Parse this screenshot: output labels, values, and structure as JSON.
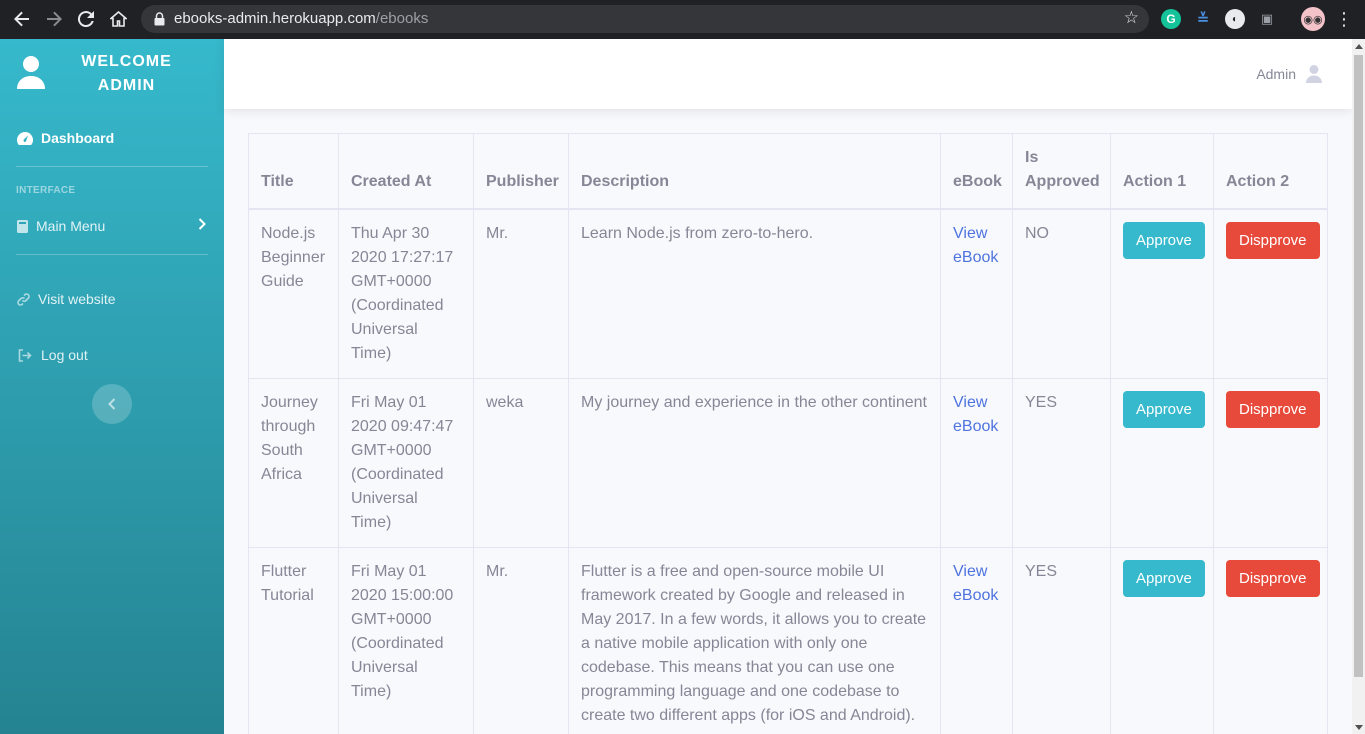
{
  "browser": {
    "url_host": "ebooks-admin.herokuapp.com",
    "url_path": "/ebooks"
  },
  "sidebar": {
    "brand_line1": "WELCOME",
    "brand_line2": "ADMIN",
    "dashboard_label": "Dashboard",
    "heading": "INTERFACE",
    "main_menu_label": "Main Menu",
    "visit_label": "Visit website",
    "logout_label": "Log out"
  },
  "topbar": {
    "user_label": "Admin"
  },
  "table": {
    "headers": {
      "title": "Title",
      "created_at": "Created At",
      "publisher": "Publisher",
      "description": "Description",
      "ebook": "eBook",
      "approved": "Is Approved",
      "action1": "Action 1",
      "action2": "Action 2"
    },
    "rows": [
      {
        "title": "Node.js Beginner Guide",
        "created_at": "Thu Apr 30 2020 17:27:17 GMT+0000 (Coordinated Universal Time)",
        "publisher": "Mr.",
        "description": "Learn Node.js from zero-to-hero.",
        "ebook_link": "View eBook",
        "approved": "NO",
        "approve_label": "Approve",
        "disapprove_label": "Dispprove"
      },
      {
        "title": "Journey through South Africa",
        "created_at": "Fri May 01 2020 09:47:47 GMT+0000 (Coordinated Universal Time)",
        "publisher": "weka",
        "description": "My journey and experience in the other continent",
        "ebook_link": "View eBook",
        "approved": "YES",
        "approve_label": "Approve",
        "disapprove_label": "Dispprove"
      },
      {
        "title": "Flutter Tutorial",
        "created_at": "Fri May 01 2020 15:00:00 GMT+0000 (Coordinated Universal Time)",
        "publisher": "Mr.",
        "description": "Flutter is a free and open-source mobile UI framework created by Google and released in May 2017. In a few words, it allows you to create a native mobile application with only one codebase. This means that you can use one programming language and one codebase to create two different apps (for iOS and Android).",
        "ebook_link": "View eBook",
        "approved": "YES",
        "approve_label": "Approve",
        "disapprove_label": "Dispprove"
      }
    ]
  },
  "colors": {
    "sidebar_top": "#36b9cc",
    "sidebar_bottom": "#258391",
    "approve": "#36b9cc",
    "disapprove": "#e74a3b",
    "link": "#4e73df"
  }
}
